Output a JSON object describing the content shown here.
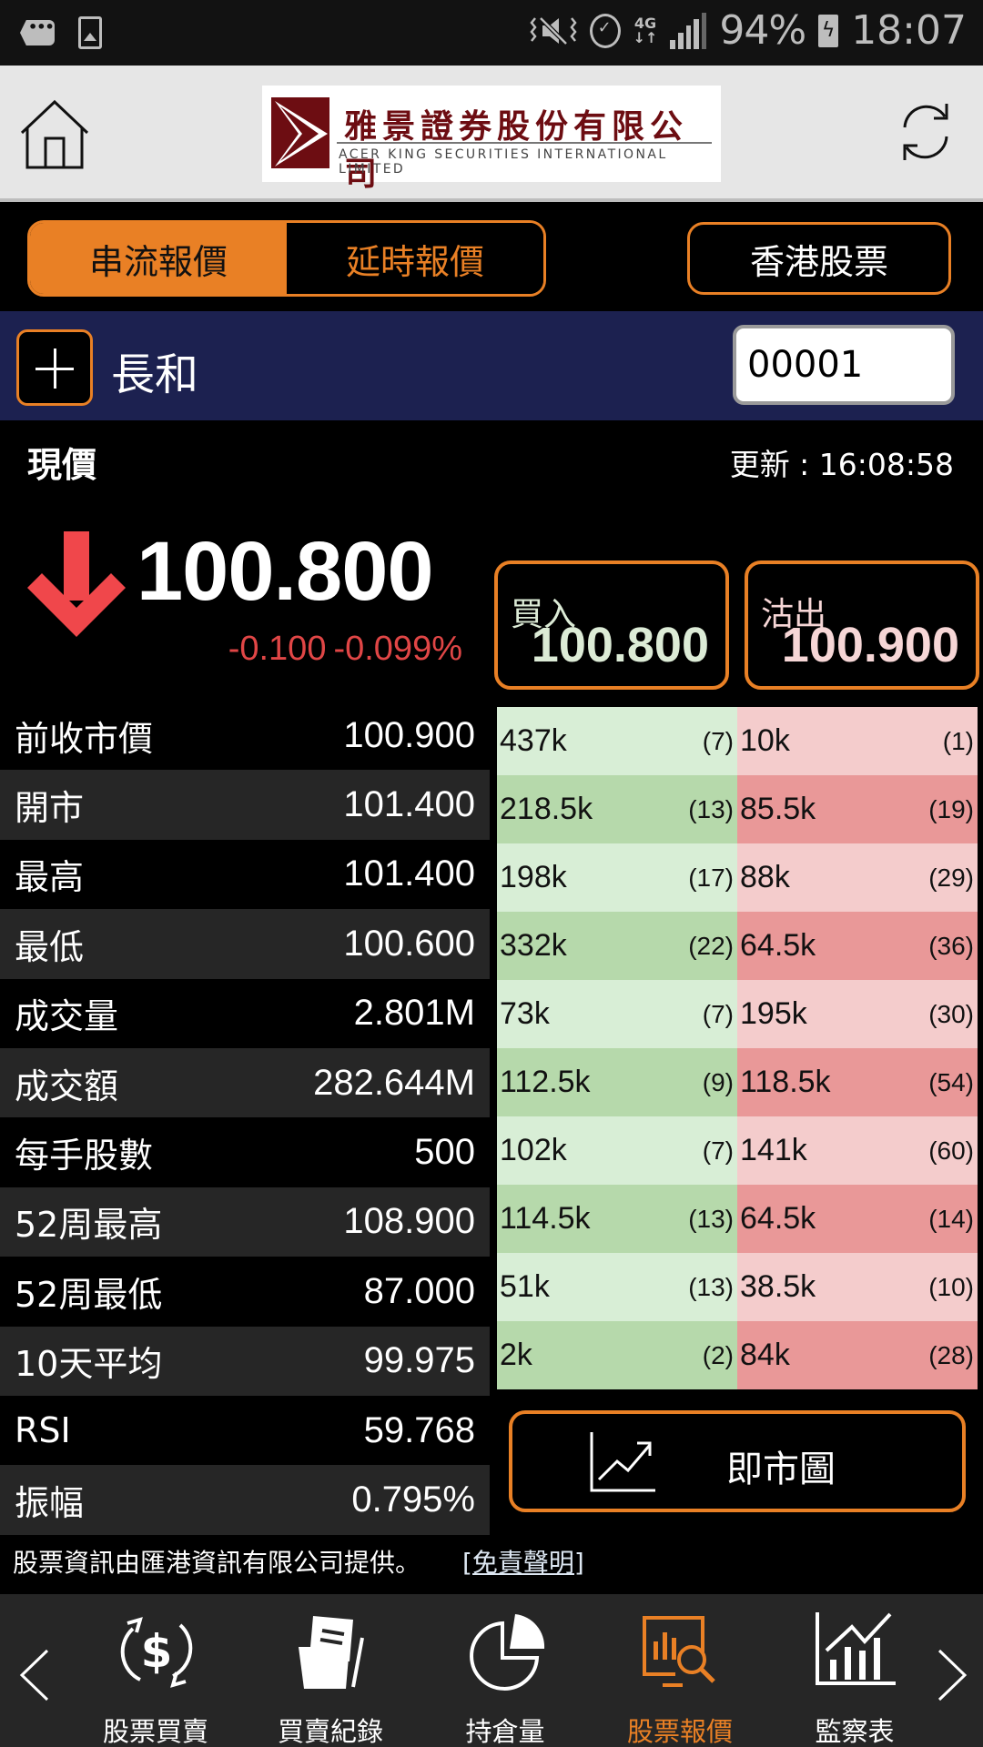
{
  "status_bar": {
    "battery": "94%",
    "time": "18:07",
    "network": "4G",
    "icons": [
      "message-icon",
      "image-icon",
      "mute-vibrate-icon",
      "alarm-icon",
      "network-4g-icon",
      "signal-icon",
      "battery-charging-icon"
    ]
  },
  "header": {
    "logo_cn": "雅景證券股份有限公司",
    "logo_en": "ACER KING SECURITIES INTERNATIONAL LIMITED",
    "home_icon": "home-icon",
    "refresh_icon": "refresh-icon"
  },
  "quote_tabs": [
    {
      "label": "串流報價",
      "active": true
    },
    {
      "label": "延時報價",
      "active": false
    }
  ],
  "market_button": "香港股票",
  "stock": {
    "name": "長和",
    "code": "00001"
  },
  "price": {
    "label": "現價",
    "update_label": "更新 : 16:08:58",
    "current": "100.800",
    "change": "-0.100",
    "change_pct": "-0.099%",
    "direction": "down"
  },
  "bid": {
    "label": "買入",
    "value": "100.800"
  },
  "ask": {
    "label": "沽出",
    "value": "100.900"
  },
  "stats": [
    {
      "label": "前收市價",
      "value": "100.900"
    },
    {
      "label": "開市",
      "value": "101.400"
    },
    {
      "label": "最高",
      "value": "101.400"
    },
    {
      "label": "最低",
      "value": "100.600"
    },
    {
      "label": "成交量",
      "value": "2.801M"
    },
    {
      "label": "成交額",
      "value": "282.644M"
    },
    {
      "label": "每手股數",
      "value": "500"
    },
    {
      "label": "52周最高",
      "value": "108.900"
    },
    {
      "label": "52周最低",
      "value": "87.000"
    },
    {
      "label": "10天平均",
      "value": "99.975"
    },
    {
      "label": "RSI",
      "value": "59.768"
    },
    {
      "label": "振幅",
      "value": "0.795%"
    }
  ],
  "order_book": [
    {
      "bid_vol": "437k",
      "bid_count": "(7)",
      "ask_vol": "10k",
      "ask_count": "(1)"
    },
    {
      "bid_vol": "218.5k",
      "bid_count": "(13)",
      "ask_vol": "85.5k",
      "ask_count": "(19)"
    },
    {
      "bid_vol": "198k",
      "bid_count": "(17)",
      "ask_vol": "88k",
      "ask_count": "(29)"
    },
    {
      "bid_vol": "332k",
      "bid_count": "(22)",
      "ask_vol": "64.5k",
      "ask_count": "(36)"
    },
    {
      "bid_vol": "73k",
      "bid_count": "(7)",
      "ask_vol": "195k",
      "ask_count": "(30)"
    },
    {
      "bid_vol": "112.5k",
      "bid_count": "(9)",
      "ask_vol": "118.5k",
      "ask_count": "(54)"
    },
    {
      "bid_vol": "102k",
      "bid_count": "(7)",
      "ask_vol": "141k",
      "ask_count": "(60)"
    },
    {
      "bid_vol": "114.5k",
      "bid_count": "(13)",
      "ask_vol": "64.5k",
      "ask_count": "(14)"
    },
    {
      "bid_vol": "51k",
      "bid_count": "(13)",
      "ask_vol": "38.5k",
      "ask_count": "(10)"
    },
    {
      "bid_vol": "2k",
      "bid_count": "(2)",
      "ask_vol": "84k",
      "ask_count": "(28)"
    }
  ],
  "chart_button": "即市圖",
  "footer": {
    "source": "股票資訊由匯港資訊有限公司提供。",
    "disclaimer": "[免責聲明]"
  },
  "bottom_nav": [
    {
      "label": "股票買賣",
      "icon": "dollar-exchange-icon",
      "active": false
    },
    {
      "label": "買賣紀錄",
      "icon": "folder-document-icon",
      "active": false
    },
    {
      "label": "持倉量",
      "icon": "pie-chart-icon",
      "active": false
    },
    {
      "label": "股票報價",
      "icon": "chart-search-icon",
      "active": true
    },
    {
      "label": "監察表",
      "icon": "bar-line-chart-icon",
      "active": false
    }
  ],
  "colors": {
    "accent": "#e98025",
    "stock_bar": "#1c2150",
    "down": "#e04646",
    "bid_light": "#d8eed6",
    "bid_dark": "#b6d9ab",
    "ask_light": "#f4cccc",
    "ask_dark": "#e99898"
  }
}
